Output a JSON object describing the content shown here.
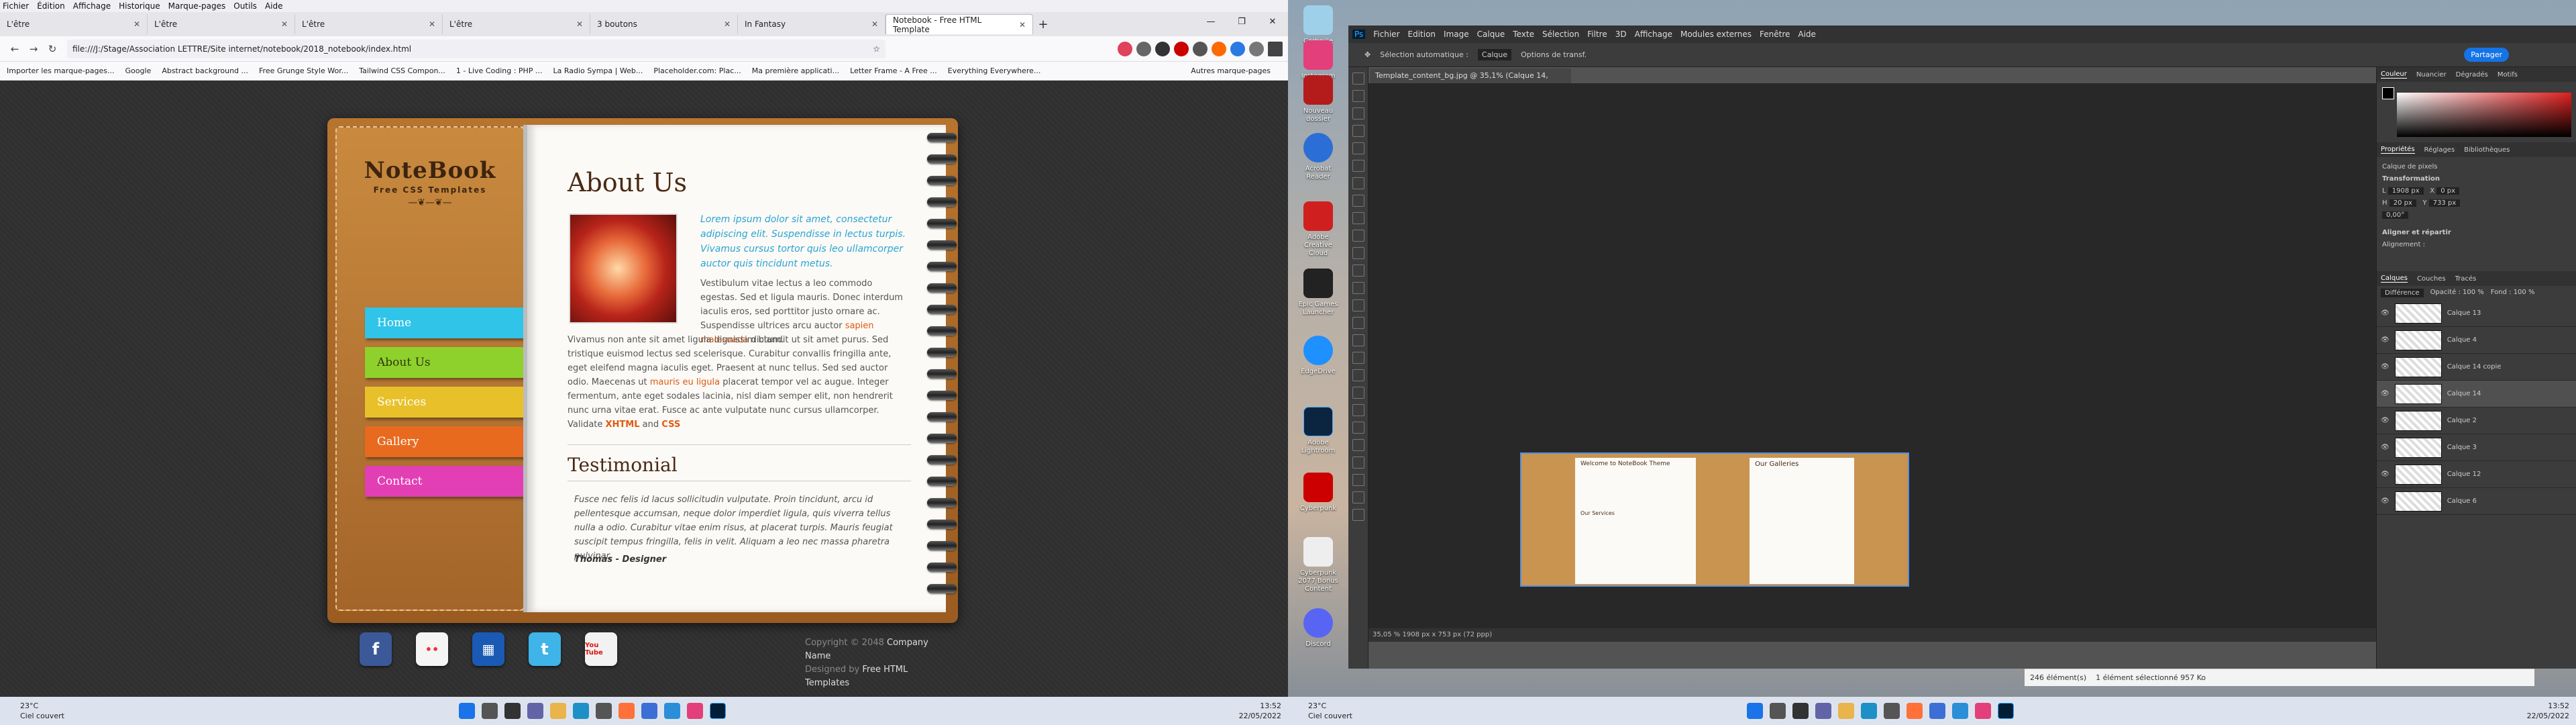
{
  "firefox": {
    "menu": [
      "Fichier",
      "Édition",
      "Affichage",
      "Historique",
      "Marque-pages",
      "Outils",
      "Aide"
    ],
    "tabs": [
      "L'être",
      "L'être",
      "L'être",
      "L'être",
      "3 boutons",
      "In Fantasy",
      "Notebook - Free HTML Template"
    ],
    "url": "file:///J:/Stage/Association LETTRE/Site internet/notebook/2018_notebook/index.html",
    "bookmarks": [
      "Importer les marque-pages...",
      "Google",
      "Abstract background ...",
      "Free Grunge Style Wor...",
      "Tailwind CSS Compon...",
      "1 - Live Coding : PHP ...",
      "La Radio Sympa | Web...",
      "Placeholder.com: Plac...",
      "Ma première applicati...",
      "Letter Frame - A Free ...",
      "Everything Everywhere...",
      "Autres marque-pages"
    ]
  },
  "site": {
    "logo_title": "NoteBook",
    "logo_sub": "Free CSS Templates",
    "logo_ornament": "—❦—❦—",
    "menu": [
      "Home",
      "About Us",
      "Services",
      "Gallery",
      "Contact"
    ],
    "menu_colors": [
      "#2fc4e8",
      "#8fd12c",
      "#e8c12a",
      "#e86a1f",
      "#e33fb5"
    ],
    "heading": "About Us",
    "intro": "Lorem ipsum dolor sit amet, consectetur adipiscing elit. Suspendisse in lectus turpis. Vivamus cursus tortor quis leo ullamcorper auctor quis tincidunt metus.",
    "body1_a": "Vestibulum vitae lectus a leo commodo egestas. Sed et ligula mauris. Donec interdum iaculis eros, sed porttitor justo ornare ac. Suspendisse ultrices arcu auctor",
    "body1_link": "sapien malesuada",
    "body1_b": "dictum.",
    "body2_a": "Vivamus non ante sit amet ligula dignissim blandit ut sit amet purus. Sed tristique euismod lectus sed scelerisque. Curabitur convallis fringilla ante, eget eleifend magna iaculis eget. Praesent at nunc tellus. Sed sed auctor odio. Maecenas ut",
    "body2_link": "mauris eu ligula",
    "body2_b": "placerat tempor vel ac augue. Integer fermentum, ante eget sodales lacinia, nisl diam semper elit, non hendrerit nunc urna vitae erat. Fusce ac ante vulputate nunc cursus ullamcorper. Validate",
    "xhtml": "XHTML",
    "and": "and",
    "css": "CSS",
    "testimonial_heading": "Testimonial",
    "quote": "Fusce nec felis id lacus sollicitudin vulputate. Proin tincidunt, arcu id pellentesque accumsan, neque dolor imperdiet ligula, quis viverra tellus nulla a odio. Curabitur vitae enim risus, at placerat turpis. Mauris feugiat suscipit tempus fringilla, felis in velit. Aliquam a leo nec massa pharetra pulvinar.",
    "author": "Thomas - Designer",
    "copyright": "Copyright © 2048",
    "company": "Company Name",
    "designed": "Designed by",
    "designer": "Free HTML Templates",
    "social": [
      "f",
      "••",
      "▦",
      "t",
      "You Tube"
    ]
  },
  "taskbar1": {
    "temp": "23°C",
    "weather": "Ciel couvert",
    "time": "13:52",
    "date": "22/05/2022"
  },
  "taskbar2": {
    "temp": "23°C",
    "weather": "Ciel couvert",
    "time": "13:52",
    "date": "22/05/2022"
  },
  "desktop_icons": [
    "Corbeille",
    "Instagram",
    "Nouveau dossier",
    "Acrobat Reader",
    "Adobe Creative Cloud",
    "Epic Games Launcher",
    "EdgeDrive",
    "Adobe Lightroom",
    "Cyberpunk",
    "Cyberpunk 2077 Bonus Content",
    "Discord"
  ],
  "photoshop": {
    "menu": [
      "Ps",
      "Fichier",
      "Edition",
      "Image",
      "Calque",
      "Texte",
      "Sélection",
      "Filtre",
      "3D",
      "Affichage",
      "Modules externes",
      "Fenêtre",
      "Aide"
    ],
    "options": [
      "Sélection automatique :",
      "Calque",
      "Options de transf."
    ],
    "share": "Partager",
    "doc_tab": "Template_content_bg.jpg @ 35,1% (Calque 14, RVB/8) *",
    "status": "35,05 %    1908 px x 753 px (72 ppp)",
    "color_tabs": [
      "Couleur",
      "Nuancier",
      "Dégradés",
      "Motifs"
    ],
    "prop_tabs": [
      "Propriétés",
      "Réglages",
      "Bibliothèques"
    ],
    "prop_layer": "Calque de pixels",
    "transform": "Transformation",
    "w": "1908 px",
    "h": "20 px",
    "x": "0 px",
    "y": "733 px",
    "angle": "0,00°",
    "align": "Aligner et répartir",
    "align_sub": "Alignement :",
    "layers_tabs": [
      "Calques",
      "Couches",
      "Tracés"
    ],
    "blend": "Différence",
    "opacity": "Opacité : 100 %",
    "fill": "Fond : 100 %",
    "layers": [
      "Calque 13",
      "Calque 4",
      "Calque 14 copie",
      "Calque 14",
      "Calque 2",
      "Calque 3",
      "Calque 12",
      "Calque 6"
    ],
    "preview_title": "Welcome to NoteBook Theme",
    "preview_gallery": "Our Galleries",
    "preview_services": "Our Services"
  },
  "explorer": {
    "count": "246 élément(s)",
    "selected": "1 élément sélectionné 957 Ko"
  }
}
